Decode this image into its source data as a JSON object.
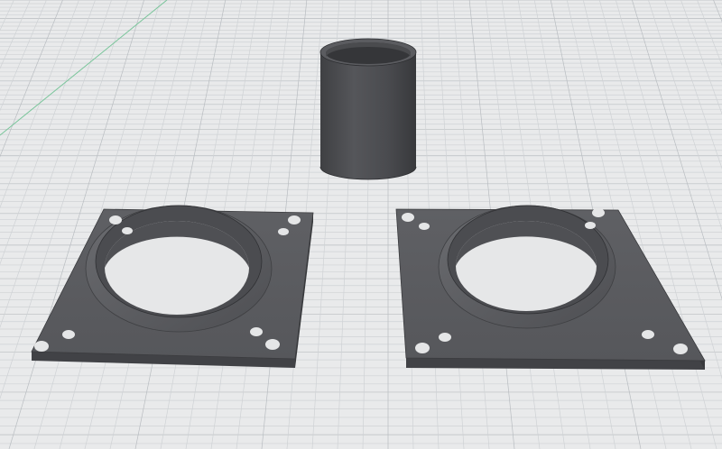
{
  "viewport": {
    "background_color": "#e9eaeb",
    "grid_minor_color": "#cfd2d5",
    "grid_major_color": "#b9bdc1",
    "axis_color": "#79c59a"
  },
  "objects": [
    {
      "name": "tube",
      "type": "cylinder",
      "color": "#4c4d51"
    },
    {
      "name": "flange-plate-left",
      "type": "flange-plate",
      "color": "#5a5b5f",
      "hole_count": 8
    },
    {
      "name": "flange-plate-right",
      "type": "flange-plate",
      "color": "#5a5b5f",
      "hole_count": 8
    }
  ]
}
